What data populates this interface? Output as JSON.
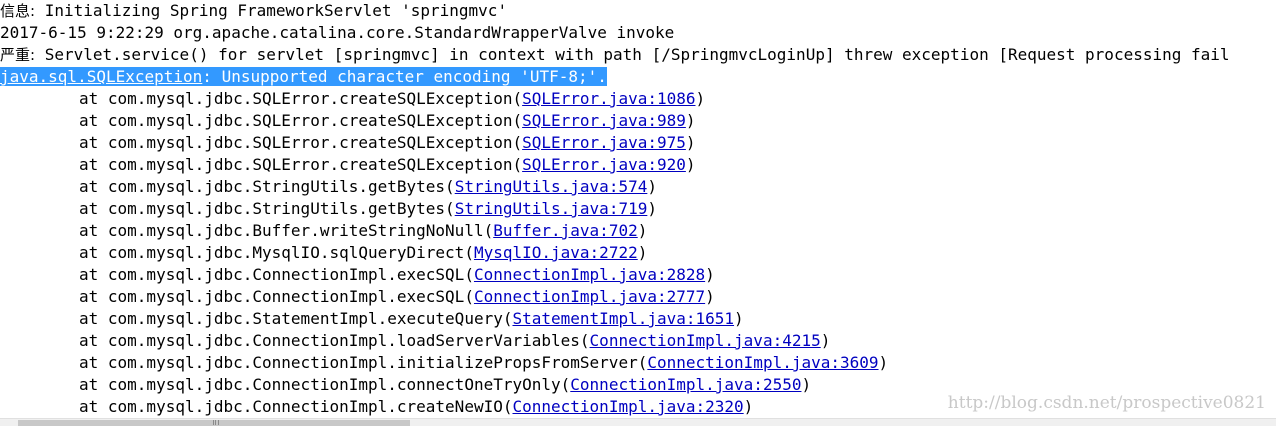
{
  "header_lines": [
    {
      "prefix": "信息:",
      "text": " Initializing Spring FrameworkServlet 'springmvc'"
    },
    {
      "text": "2017-6-15 9:22:29 org.apache.catalina.core.StandardWrapperValve invoke"
    },
    {
      "prefix": "严重:",
      "text": " Servlet.service() for servlet [springmvc] in context with path [/SpringmvcLoginUp] threw exception [Request processing fail"
    }
  ],
  "exception_line": {
    "link": "java.sql.SQLException",
    "text": ": Unsupported character encoding 'UTF-8;'."
  },
  "stack": [
    {
      "method": "at com.mysql.jdbc.SQLError.createSQLException(",
      "link": "SQLError.java:1086",
      "tail": ")"
    },
    {
      "method": "at com.mysql.jdbc.SQLError.createSQLException(",
      "link": "SQLError.java:989",
      "tail": ")"
    },
    {
      "method": "at com.mysql.jdbc.SQLError.createSQLException(",
      "link": "SQLError.java:975",
      "tail": ")"
    },
    {
      "method": "at com.mysql.jdbc.SQLError.createSQLException(",
      "link": "SQLError.java:920",
      "tail": ")"
    },
    {
      "method": "at com.mysql.jdbc.StringUtils.getBytes(",
      "link": "StringUtils.java:574",
      "tail": ")"
    },
    {
      "method": "at com.mysql.jdbc.StringUtils.getBytes(",
      "link": "StringUtils.java:719",
      "tail": ")"
    },
    {
      "method": "at com.mysql.jdbc.Buffer.writeStringNoNull(",
      "link": "Buffer.java:702",
      "tail": ")"
    },
    {
      "method": "at com.mysql.jdbc.MysqlIO.sqlQueryDirect(",
      "link": "MysqlIO.java:2722",
      "tail": ")"
    },
    {
      "method": "at com.mysql.jdbc.ConnectionImpl.execSQL(",
      "link": "ConnectionImpl.java:2828",
      "tail": ")"
    },
    {
      "method": "at com.mysql.jdbc.ConnectionImpl.execSQL(",
      "link": "ConnectionImpl.java:2777",
      "tail": ")"
    },
    {
      "method": "at com.mysql.jdbc.StatementImpl.executeQuery(",
      "link": "StatementImpl.java:1651",
      "tail": ")"
    },
    {
      "method": "at com.mysql.jdbc.ConnectionImpl.loadServerVariables(",
      "link": "ConnectionImpl.java:4215",
      "tail": ")"
    },
    {
      "method": "at com.mysql.jdbc.ConnectionImpl.initializePropsFromServer(",
      "link": "ConnectionImpl.java:3609",
      "tail": ")"
    },
    {
      "method": "at com.mysql.jdbc.ConnectionImpl.connectOneTryOnly(",
      "link": "ConnectionImpl.java:2550",
      "tail": ")"
    },
    {
      "method": "at com.mysql.jdbc.ConnectionImpl.createNewIO(",
      "link": "ConnectionImpl.java:2320",
      "tail": ")"
    }
  ],
  "watermark": "http://blog.csdn.net/prospective0821",
  "colors": {
    "link": "#0000c0",
    "selection": "#3399ff",
    "watermark": "#c8c8c8"
  }
}
